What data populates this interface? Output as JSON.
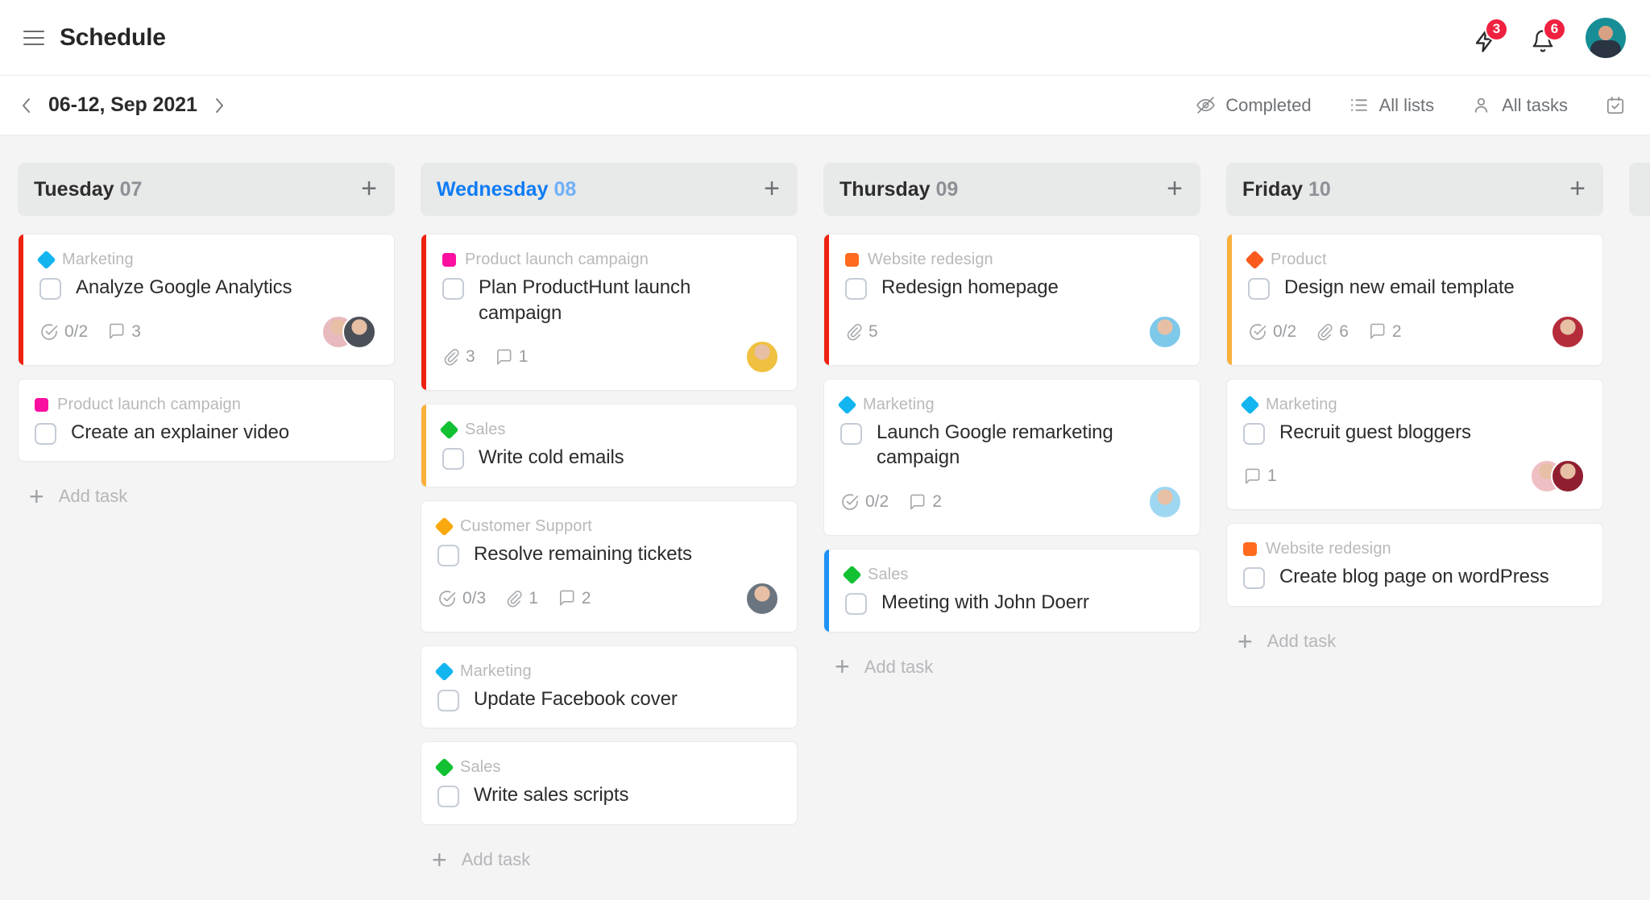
{
  "header": {
    "menu_icon": "hamburger-icon",
    "title": "Schedule",
    "bolt_icon": "lightning-bolt-icon",
    "bolt_badge": "3",
    "bell_icon": "bell-icon",
    "bell_badge": "6",
    "avatar_name": "user-avatar"
  },
  "toolbar": {
    "prev_label": "‹",
    "next_label": "›",
    "date_range": "06-12, Sep 2021",
    "actions": [
      {
        "label": "Completed",
        "icon": "eye-off-icon"
      },
      {
        "label": "All lists",
        "icon": "list-icon"
      },
      {
        "label": "All tasks",
        "icon": "person-icon"
      }
    ],
    "calendar_icon": "calendar-check-icon"
  },
  "board": {
    "add_task_label": "Add task",
    "add_column_label": "+",
    "columns": [
      {
        "day": "Tuesday",
        "date": "07",
        "today": false,
        "cards": [
          {
            "accent": "#ee2211",
            "tag": {
              "name": "Marketing",
              "color": "#12b5f0",
              "shape": "diamond"
            },
            "title": "Analyze Google Analytics",
            "subtasks": "0/2",
            "attachments": null,
            "comments": "3",
            "avatars": [
              "#e8b9bd",
              "#4b4f58"
            ]
          },
          {
            "accent": null,
            "tag": {
              "name": "Product launch campaign",
              "color": "#fb0fa0",
              "shape": "square"
            },
            "title": "Create an explainer video",
            "subtasks": null,
            "attachments": null,
            "comments": null,
            "avatars": []
          }
        ]
      },
      {
        "day": "Wednesday",
        "date": "08",
        "today": true,
        "cards": [
          {
            "accent": "#ee2211",
            "tag": {
              "name": "Product launch campaign",
              "color": "#fb0fa0",
              "shape": "square"
            },
            "title": "Plan ProductHunt launch campaign",
            "subtasks": null,
            "attachments": "3",
            "comments": "1",
            "avatars": [
              "#f0c040"
            ]
          },
          {
            "accent": "#fbb03b",
            "tag": {
              "name": "Sales",
              "color": "#12c132",
              "shape": "diamond"
            },
            "title": "Write cold emails",
            "subtasks": null,
            "attachments": null,
            "comments": null,
            "avatars": []
          },
          {
            "accent": null,
            "tag": {
              "name": "Customer Support",
              "color": "#f9a90e",
              "shape": "diamond"
            },
            "title": "Resolve remaining tickets",
            "subtasks": "0/3",
            "attachments": "1",
            "comments": "2",
            "avatars": [
              "#6b7580"
            ]
          },
          {
            "accent": null,
            "tag": {
              "name": "Marketing",
              "color": "#12b5f0",
              "shape": "diamond"
            },
            "title": "Update Facebook cover",
            "subtasks": null,
            "attachments": null,
            "comments": null,
            "avatars": []
          },
          {
            "accent": null,
            "tag": {
              "name": "Sales",
              "color": "#12c132",
              "shape": "diamond"
            },
            "title": "Write sales scripts",
            "subtasks": null,
            "attachments": null,
            "comments": null,
            "avatars": []
          }
        ]
      },
      {
        "day": "Thursday",
        "date": "09",
        "today": false,
        "cards": [
          {
            "accent": "#ee2211",
            "tag": {
              "name": "Website redesign",
              "color": "#ff6a1e",
              "shape": "square"
            },
            "title": "Redesign homepage",
            "subtasks": null,
            "attachments": "5",
            "comments": null,
            "avatars": [
              "#7ec8ea"
            ]
          },
          {
            "accent": null,
            "tag": {
              "name": "Marketing",
              "color": "#12b5f0",
              "shape": "diamond"
            },
            "title": "Launch Google remarketing campaign",
            "subtasks": "0/2",
            "attachments": null,
            "comments": "2",
            "avatars": [
              "#9ed7f2"
            ]
          },
          {
            "accent": "#1f92f5",
            "tag": {
              "name": "Sales",
              "color": "#12c132",
              "shape": "diamond"
            },
            "title": "Meeting with John Doerr",
            "subtasks": null,
            "attachments": null,
            "comments": null,
            "avatars": []
          }
        ]
      },
      {
        "day": "Friday",
        "date": "10",
        "today": false,
        "cards": [
          {
            "accent": "#fbb03b",
            "tag": {
              "name": "Product",
              "color": "#fb5a1e",
              "shape": "diamond"
            },
            "title": "Design new email template",
            "subtasks": "0/2",
            "attachments": "6",
            "comments": "2",
            "avatars": [
              "#b42c3a"
            ]
          },
          {
            "accent": null,
            "tag": {
              "name": "Marketing",
              "color": "#12b5f0",
              "shape": "diamond"
            },
            "title": "Recruit guest bloggers",
            "subtasks": null,
            "attachments": null,
            "comments": "1",
            "avatars": [
              "#efbfc4",
              "#8f1f30"
            ]
          },
          {
            "accent": null,
            "tag": {
              "name": "Website redesign",
              "color": "#ff6a1e",
              "shape": "square"
            },
            "title": "Create blog page on wordPress",
            "subtasks": null,
            "attachments": null,
            "comments": null,
            "avatars": []
          }
        ]
      }
    ]
  }
}
